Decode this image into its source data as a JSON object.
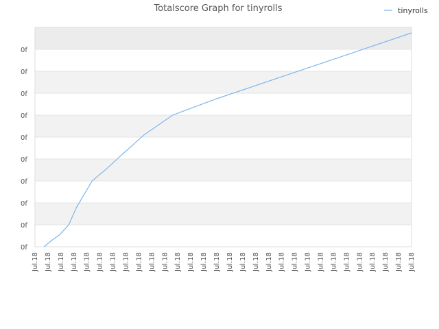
{
  "chart_data": {
    "type": "line",
    "title": "Totalscore Graph for tinyrolls",
    "xlabel": "",
    "ylabel": "",
    "legend_position": "top-right",
    "grid": true,
    "series_color": "#7cb5ec",
    "y_tick_labels": [
      "0f",
      "0f",
      "0f",
      "0f",
      "0f",
      "0f",
      "0f",
      "0f",
      "0f",
      "0f"
    ],
    "x_tick_labels": [
      "Jul.18",
      "Jul.18",
      "Jul.18",
      "Jul.18",
      "Jul.18",
      "Jul.18",
      "Jul.18",
      "Jul.18",
      "Jul.18",
      "Jul.18",
      "Jul.18",
      "Jul.18",
      "Jul.18",
      "Jul.18",
      "Jul.18",
      "Jul.18",
      "Jul.18",
      "Jul.18",
      "Jul.18",
      "Jul.18",
      "Jul.18",
      "Jul.18",
      "Jul.18",
      "Jul.18",
      "Jul.18",
      "Jul.18",
      "Jul.18",
      "Jul.18",
      "Jul.18",
      "Jul.18"
    ],
    "series": [
      {
        "name": "tinyrolls",
        "x": [
          0.7,
          1.2,
          1.9,
          2.6,
          3.2,
          4.4,
          5.6,
          6.7,
          8.4,
          10.6,
          11.5,
          14.0,
          17.0,
          20.0,
          23.0,
          26.0,
          29.0
        ],
        "y": [
          0,
          0.25,
          0.55,
          1.0,
          1.8,
          3.0,
          3.6,
          4.2,
          5.1,
          6.0,
          6.2,
          6.75,
          7.35,
          7.95,
          8.55,
          9.15,
          9.75
        ]
      }
    ],
    "xlim": [
      0,
      29
    ],
    "ylim": [
      0,
      10
    ]
  }
}
